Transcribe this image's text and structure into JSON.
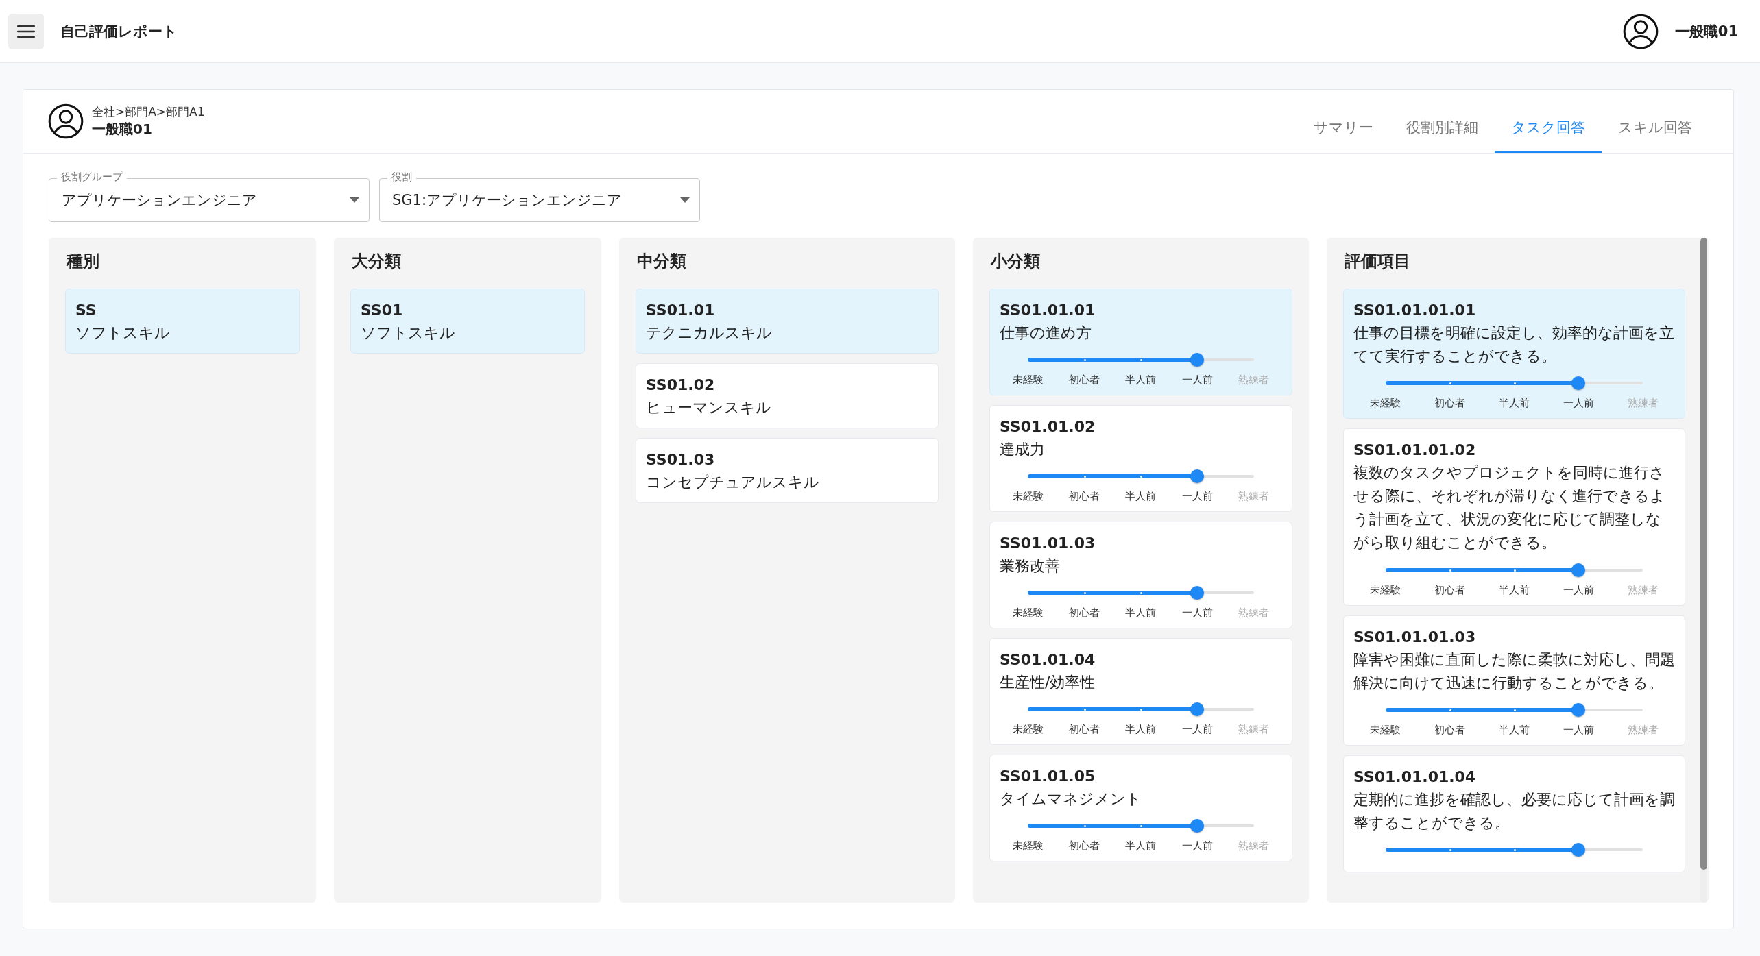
{
  "app_bar": {
    "title": "自己評価レポート",
    "user": "一般職01"
  },
  "profile": {
    "breadcrumb": "全社>部門A>部門A1",
    "name": "一般職01"
  },
  "tabs": [
    {
      "label": "サマリー",
      "selected": false
    },
    {
      "label": "役割別詳細",
      "selected": false
    },
    {
      "label": "タスク回答",
      "selected": true
    },
    {
      "label": "スキル回答",
      "selected": false
    }
  ],
  "filters": [
    {
      "label": "役割グループ",
      "value": "アプリケーションエンジニア"
    },
    {
      "label": "役割",
      "value": "SG1:アプリケーションエンジニア"
    }
  ],
  "columns": [
    {
      "title": "種別",
      "items": [
        {
          "kind": "plain",
          "code": "SS",
          "name": "ソフトスキル",
          "selected": true
        }
      ]
    },
    {
      "title": "大分類",
      "items": [
        {
          "kind": "plain",
          "code": "SS01",
          "name": "ソフトスキル",
          "selected": true
        }
      ]
    },
    {
      "title": "中分類",
      "items": [
        {
          "kind": "plain",
          "code": "SS01.01",
          "name": "テクニカルスキル",
          "selected": true
        },
        {
          "kind": "plain",
          "code": "SS01.02",
          "name": "ヒューマンスキル",
          "selected": false
        },
        {
          "kind": "plain",
          "code": "SS01.03",
          "name": "コンセプチュアルスキル",
          "selected": false
        }
      ]
    },
    {
      "title": "小分類",
      "items": [
        {
          "kind": "rated",
          "code": "SS01.01.01",
          "name": "仕事の進め方",
          "selected": true,
          "level": 0.75,
          "scale": [
            "未経験",
            "初心者",
            "半人前",
            "一人前",
            "熟練者"
          ]
        },
        {
          "kind": "rated",
          "code": "SS01.01.02",
          "name": "達成力",
          "selected": false,
          "level": 0.75,
          "scale": [
            "未経験",
            "初心者",
            "半人前",
            "一人前",
            "熟練者"
          ]
        },
        {
          "kind": "rated",
          "code": "SS01.01.03",
          "name": "業務改善",
          "selected": false,
          "level": 0.75,
          "scale": [
            "未経験",
            "初心者",
            "半人前",
            "一人前",
            "熟練者"
          ]
        },
        {
          "kind": "rated",
          "code": "SS01.01.04",
          "name": "生産性/効率性",
          "selected": false,
          "level": 0.75,
          "scale": [
            "未経験",
            "初心者",
            "半人前",
            "一人前",
            "熟練者"
          ]
        },
        {
          "kind": "rated",
          "code": "SS01.01.05",
          "name": "タイムマネジメント",
          "selected": false,
          "level": 0.75,
          "scale": [
            "未経験",
            "初心者",
            "半人前",
            "一人前",
            "熟練者"
          ]
        }
      ]
    },
    {
      "title": "評価項目",
      "items": [
        {
          "kind": "rated",
          "code": "SS01.01.01.01",
          "name": "仕事の目標を明確に設定し、効率的な計画を立てて実行することができる。",
          "selected": true,
          "level": 0.75,
          "scale": [
            "未経験",
            "初心者",
            "半人前",
            "一人前",
            "熟練者"
          ]
        },
        {
          "kind": "rated",
          "code": "SS01.01.01.02",
          "name": "複数のタスクやプロジェクトを同時に進行させる際に、それぞれが滞りなく進行できるよう計画を立て、状況の変化に応じて調整しながら取り組むことができる。",
          "selected": false,
          "level": 0.75,
          "scale": [
            "未経験",
            "初心者",
            "半人前",
            "一人前",
            "熟練者"
          ]
        },
        {
          "kind": "rated",
          "code": "SS01.01.01.03",
          "name": "障害や困難に直面した際に柔軟に対応し、問題解決に向けて迅速に行動することができる。",
          "selected": false,
          "level": 0.75,
          "scale": [
            "未経験",
            "初心者",
            "半人前",
            "一人前",
            "熟練者"
          ]
        },
        {
          "kind": "rated",
          "code": "SS01.01.01.04",
          "name": "定期的に進捗を確認し、必要に応じて計画を調整することができる。",
          "selected": false,
          "level": 0.75
        }
      ]
    }
  ]
}
